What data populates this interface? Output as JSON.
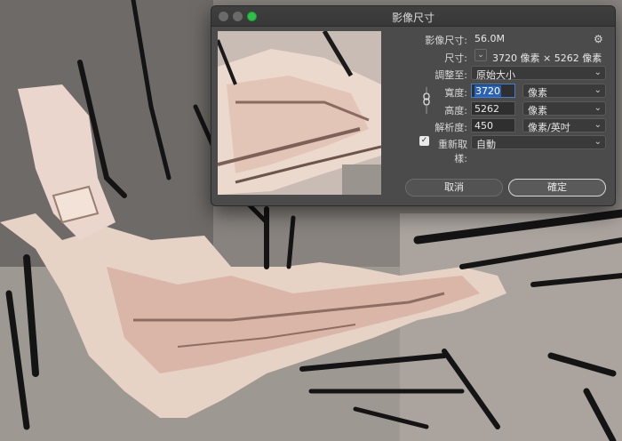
{
  "dialog": {
    "title": "影像尺寸",
    "image_size_label": "影像尺寸:",
    "image_size_value": "56.0M",
    "dimensions_label": "尺寸:",
    "dimensions_value": "3720 像素 × 5262 像素",
    "fit_to_label": "調整至:",
    "fit_to_value": "原始大小",
    "width_label": "寬度:",
    "width_value": "3720",
    "width_unit": "像素",
    "height_label": "高度:",
    "height_value": "5262",
    "height_unit": "像素",
    "resolution_label": "解析度:",
    "resolution_value": "450",
    "resolution_unit": "像素/英吋",
    "resample_label": "重新取樣:",
    "resample_checked": true,
    "resample_value": "自動",
    "cancel_label": "取消",
    "ok_label": "確定"
  },
  "icons": {
    "gear": "gear-icon",
    "chain": "chain-link-icon",
    "chevron": "chevron-down-icon"
  },
  "colors": {
    "dialog_bg": "#4b4b4b",
    "accent_focus": "#3d82d6",
    "maximize_button": "#2fc04a"
  }
}
